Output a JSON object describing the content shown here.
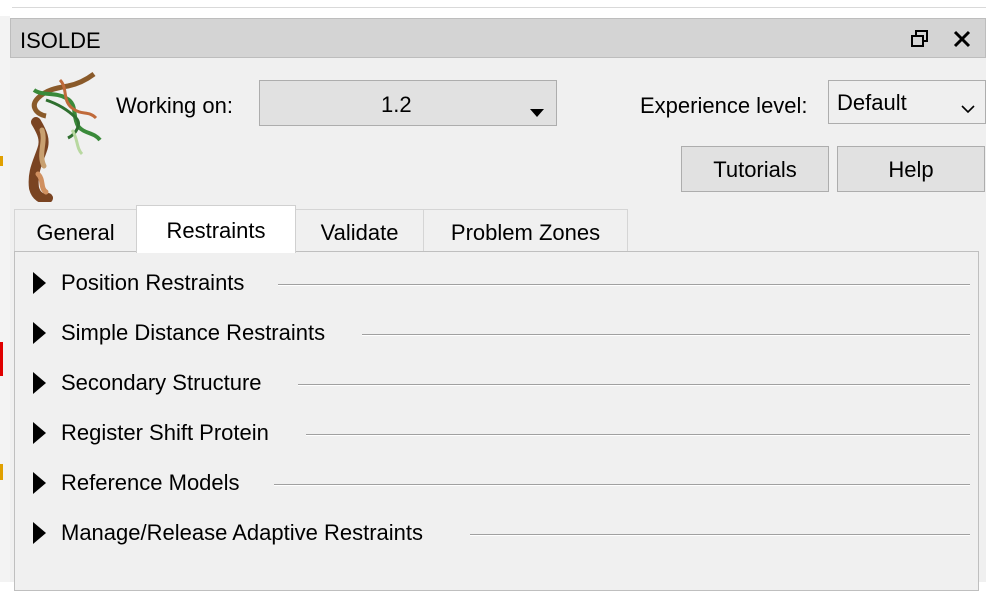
{
  "window": {
    "title": "ISOLDE",
    "restore_icon": "restore-icon",
    "close_icon": "close-icon"
  },
  "header": {
    "working_on_label": "Working on:",
    "working_on_value": "1.2",
    "experience_label": "Experience level:",
    "experience_value": "Default",
    "tutorials_label": "Tutorials",
    "help_label": "Help"
  },
  "tabs": [
    {
      "label": "General",
      "active": false
    },
    {
      "label": "Restraints",
      "active": true
    },
    {
      "label": "Validate",
      "active": false
    },
    {
      "label": "Problem Zones",
      "active": false
    }
  ],
  "sections": [
    {
      "label": "Position Restraints"
    },
    {
      "label": "Simple Distance Restraints"
    },
    {
      "label": "Secondary Structure"
    },
    {
      "label": "Register Shift Protein"
    },
    {
      "label": "Reference Models"
    },
    {
      "label": "Manage/Release Adaptive Restraints"
    }
  ],
  "colors": {
    "titlebar": "#d4d4d4",
    "panel": "#f0f0f0",
    "button": "#e1e1e1"
  }
}
